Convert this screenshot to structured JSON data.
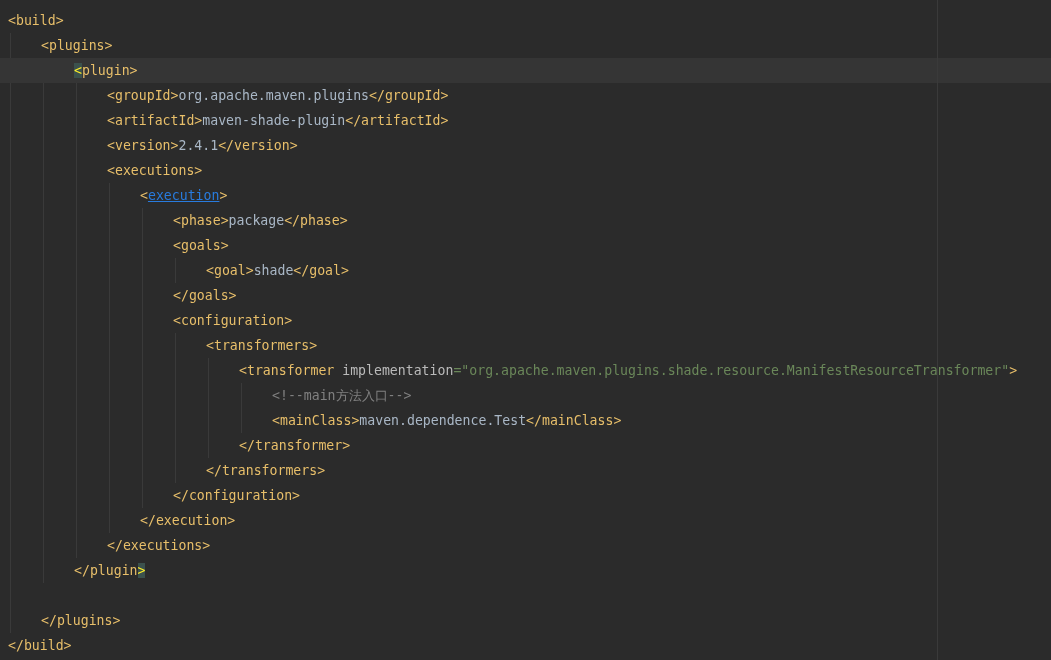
{
  "editor": {
    "lines": [
      {
        "tokens": [
          {
            "kind": "tag",
            "text": "<build>"
          }
        ],
        "children": [
          {
            "tokens": [
              {
                "kind": "tag",
                "text": "<plugins>"
              }
            ],
            "children": [
              {
                "current": true,
                "tokens": [
                  {
                    "kind": "match",
                    "text": "<"
                  },
                  {
                    "kind": "tag",
                    "text": "plugin>"
                  }
                ],
                "children": [
                  {
                    "tokens": [
                      {
                        "kind": "tag",
                        "text": "<groupId>"
                      },
                      {
                        "kind": "text",
                        "text": "org.apache.maven.plugins"
                      },
                      {
                        "kind": "tag",
                        "text": "</groupId>"
                      }
                    ]
                  },
                  {
                    "tokens": [
                      {
                        "kind": "tag",
                        "text": "<artifactId>"
                      },
                      {
                        "kind": "text",
                        "text": "maven-shade-plugin"
                      },
                      {
                        "kind": "tag",
                        "text": "</artifactId>"
                      }
                    ]
                  },
                  {
                    "tokens": [
                      {
                        "kind": "tag",
                        "text": "<version>"
                      },
                      {
                        "kind": "text",
                        "text": "2.4.1"
                      },
                      {
                        "kind": "tag",
                        "text": "</version>"
                      }
                    ]
                  },
                  {
                    "tokens": [
                      {
                        "kind": "tag",
                        "text": "<executions>"
                      }
                    ],
                    "children": [
                      {
                        "tokens": [
                          {
                            "kind": "tag",
                            "text": "<"
                          },
                          {
                            "kind": "link",
                            "text": "execution"
                          },
                          {
                            "kind": "tag",
                            "text": ">"
                          }
                        ],
                        "children": [
                          {
                            "tokens": [
                              {
                                "kind": "tag",
                                "text": "<phase>"
                              },
                              {
                                "kind": "text",
                                "text": "package"
                              },
                              {
                                "kind": "tag",
                                "text": "</phase>"
                              }
                            ]
                          },
                          {
                            "tokens": [
                              {
                                "kind": "tag",
                                "text": "<goals>"
                              }
                            ],
                            "children": [
                              {
                                "tokens": [
                                  {
                                    "kind": "tag",
                                    "text": "<goal>"
                                  },
                                  {
                                    "kind": "text",
                                    "text": "shade"
                                  },
                                  {
                                    "kind": "tag",
                                    "text": "</goal>"
                                  }
                                ]
                              }
                            ]
                          },
                          {
                            "tokens": [
                              {
                                "kind": "tag",
                                "text": "</goals>"
                              }
                            ]
                          },
                          {
                            "tokens": [
                              {
                                "kind": "tag",
                                "text": "<configuration>"
                              }
                            ],
                            "children": [
                              {
                                "tokens": [
                                  {
                                    "kind": "tag",
                                    "text": "<transformers>"
                                  }
                                ],
                                "children": [
                                  {
                                    "tokens": [
                                      {
                                        "kind": "tag",
                                        "text": "<transformer"
                                      },
                                      {
                                        "kind": "attr",
                                        "text": " implementation"
                                      },
                                      {
                                        "kind": "value",
                                        "text": "=\"org.apache.maven.plugins.shade.resource.ManifestResourceTransformer\""
                                      },
                                      {
                                        "kind": "tag",
                                        "text": ">"
                                      }
                                    ],
                                    "children": [
                                      {
                                        "tokens": [
                                          {
                                            "kind": "comment",
                                            "text": "<!--main方法入口-->"
                                          }
                                        ]
                                      },
                                      {
                                        "tokens": [
                                          {
                                            "kind": "tag",
                                            "text": "<mainClass>"
                                          },
                                          {
                                            "kind": "text",
                                            "text": "maven.dependence.Test"
                                          },
                                          {
                                            "kind": "tag",
                                            "text": "</mainClass>"
                                          }
                                        ]
                                      }
                                    ]
                                  },
                                  {
                                    "tokens": [
                                      {
                                        "kind": "tag",
                                        "text": "</transformer>"
                                      }
                                    ]
                                  }
                                ]
                              },
                              {
                                "tokens": [
                                  {
                                    "kind": "tag",
                                    "text": "</transformers>"
                                  }
                                ]
                              }
                            ]
                          },
                          {
                            "tokens": [
                              {
                                "kind": "tag",
                                "text": "</configuration>"
                              }
                            ]
                          }
                        ]
                      },
                      {
                        "tokens": [
                          {
                            "kind": "tag",
                            "text": "</execution>"
                          }
                        ]
                      }
                    ]
                  },
                  {
                    "tokens": [
                      {
                        "kind": "tag",
                        "text": "</executions>"
                      }
                    ]
                  }
                ]
              },
              {
                "blank_after": true,
                "tokens": [
                  {
                    "kind": "tag",
                    "text": "</plugin"
                  },
                  {
                    "kind": "match",
                    "text": ">"
                  }
                ]
              }
            ]
          },
          {
            "tokens": [
              {
                "kind": "tag",
                "text": "</plugins>"
              }
            ]
          }
        ]
      },
      {
        "tokens": [
          {
            "kind": "tag",
            "text": "</build>"
          }
        ]
      }
    ]
  }
}
